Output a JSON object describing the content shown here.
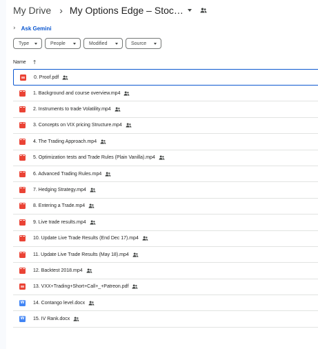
{
  "breadcrumb": {
    "root": "My Drive",
    "separator": "›",
    "current": "My Options Edge – Stoc…"
  },
  "gemini": {
    "chevron": "›",
    "label": "Ask Gemini"
  },
  "filters": [
    "Type",
    "People",
    "Modified",
    "Source"
  ],
  "columns": {
    "name": "Name",
    "sort_arrow": "↑"
  },
  "files": [
    {
      "name": "0. Proof.pdf",
      "icon": "pdf-icon",
      "selected": true
    },
    {
      "name": "1. Background and course overview.mp4",
      "icon": "video-icon"
    },
    {
      "name": "2. Instruments to trade Volatility.mp4",
      "icon": "video-icon"
    },
    {
      "name": "3. Concepts on VIX pricing Structure.mp4",
      "icon": "video-icon"
    },
    {
      "name": "4. The Trading Approach.mp4",
      "icon": "video-icon"
    },
    {
      "name": "5. Optimization tests and Trade Rules (Plain Vanilla).mp4",
      "icon": "video-icon"
    },
    {
      "name": "6. Advanced Trading Rules.mp4",
      "icon": "video-icon"
    },
    {
      "name": "7. Hedging Strategy.mp4",
      "icon": "video-icon"
    },
    {
      "name": "8. Entering a Trade.mp4",
      "icon": "video-icon"
    },
    {
      "name": "9. Live trade results.mp4",
      "icon": "video-icon"
    },
    {
      "name": "10. Update Live Trade Results (End Dec 17).mp4",
      "icon": "video-icon"
    },
    {
      "name": "11. Update Live Trade Results (May 18).mp4",
      "icon": "video-icon"
    },
    {
      "name": "12. Backtest 2018.mp4",
      "icon": "video-icon"
    },
    {
      "name": "13. VXX+Trading+Short+Call+_+Patreon.pdf",
      "icon": "pdf-icon"
    },
    {
      "name": "14. Contango level.docx",
      "icon": "doc-icon"
    },
    {
      "name": "15. IV Rank.docx",
      "icon": "doc-icon"
    }
  ],
  "colors": {
    "accent": "#0b57d0",
    "pdf": "#ea4335",
    "doc": "#4285f4"
  }
}
